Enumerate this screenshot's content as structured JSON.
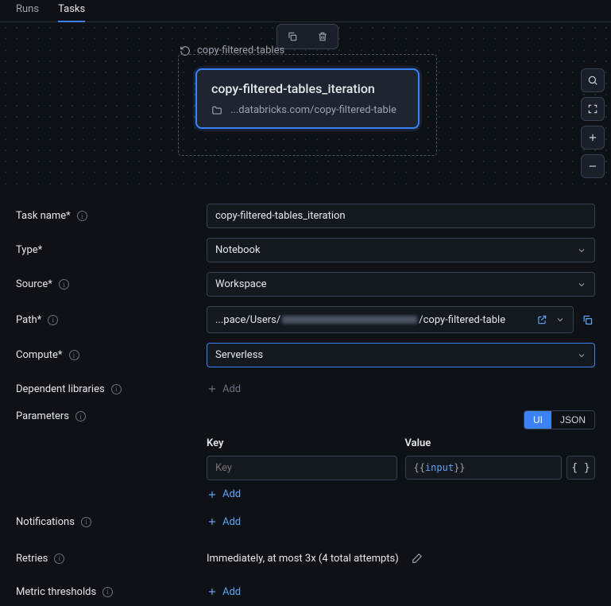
{
  "tabs": {
    "runs": "Runs",
    "tasks": "Tasks"
  },
  "canvas": {
    "iteration_label": "copy-filtered-tables",
    "node_title": "copy-filtered-tables_iteration",
    "node_path": "...databricks.com/copy-filtered-table"
  },
  "form": {
    "task_name_label": "Task name*",
    "task_name_value": "copy-filtered-tables_iteration",
    "type_label": "Type*",
    "type_value": "Notebook",
    "source_label": "Source*",
    "source_value": "Workspace",
    "path_label": "Path*",
    "path_prefix": "...pace/Users/",
    "path_suffix": "/copy-filtered-table",
    "compute_label": "Compute*",
    "compute_value": "Serverless",
    "dep_libs_label": "Dependent libraries",
    "parameters_label": "Parameters",
    "notifications_label": "Notifications",
    "retries_label": "Retries",
    "retries_value": "Immediately, at most 3x (4 total attempts)",
    "metrics_label": "Metric thresholds",
    "add_text": "Add"
  },
  "params": {
    "ui": "UI",
    "json": "JSON",
    "key_header": "Key",
    "value_header": "Value",
    "key_placeholder": "Key",
    "value_open": "{{",
    "value_var": "input",
    "value_close": "}}"
  }
}
